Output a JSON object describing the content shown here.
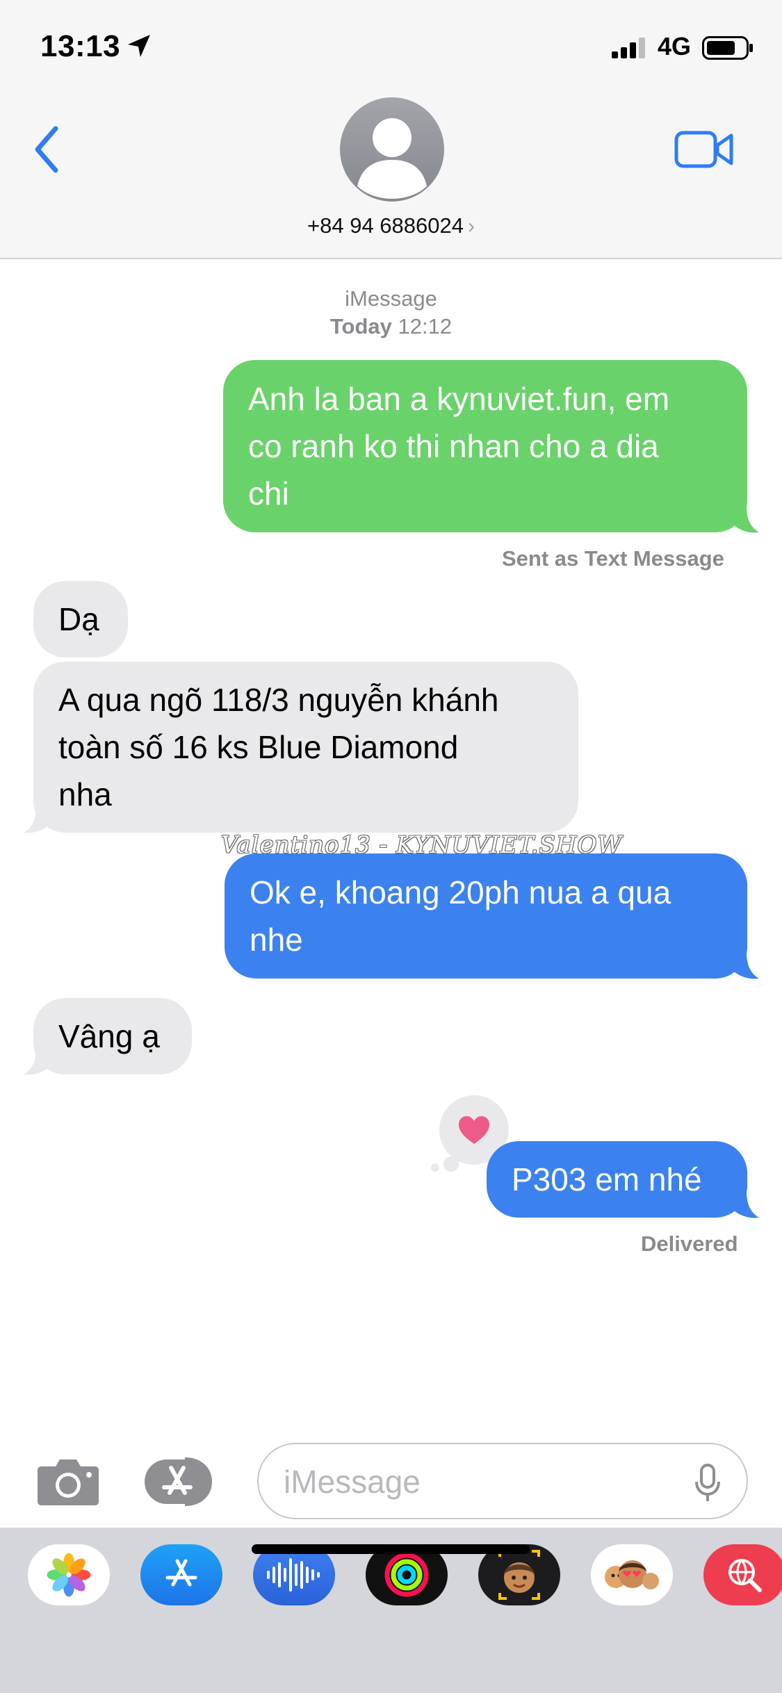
{
  "status_bar": {
    "time": "13:13",
    "network": "4G"
  },
  "header": {
    "contact": "+84 94 6886024",
    "chevron": "›"
  },
  "conversation": {
    "service": "iMessage",
    "day": "Today",
    "time": "12:12",
    "messages": [
      {
        "from": "me",
        "kind": "sms",
        "lines": [
          "Anh la ban a kynuviet.fun, em",
          "co ranh ko thi nhan cho a dia",
          "chi"
        ]
      },
      {
        "from": "them",
        "lines": [
          "Dạ"
        ]
      },
      {
        "from": "them",
        "lines": [
          "A qua ngõ 118/3 nguyễn khánh",
          "toàn số 16 ks Blue Diamond",
          "nha"
        ]
      },
      {
        "from": "me",
        "kind": "imessage",
        "lines": [
          "Ok e, khoang 20ph nua a qua",
          "nhe"
        ]
      },
      {
        "from": "them",
        "lines": [
          "Vâng ạ"
        ]
      },
      {
        "from": "me",
        "kind": "imessage",
        "lines": [
          "P303 em nhé"
        ],
        "reaction": "heart-icon"
      }
    ],
    "sent_note": "Sent as Text Message",
    "delivered_note": "Delivered",
    "watermark": "Valentino13 - KYNUVIET.SHOW"
  },
  "input": {
    "placeholder": "iMessage",
    "value": ""
  },
  "app_drawer": [
    "photos-app",
    "app-store-app",
    "audio-message-app",
    "activity-app",
    "memoji-app",
    "memoji-stickers-app",
    "images-search-app"
  ],
  "colors": {
    "sms_green": "#6ad26a",
    "imessage_blue": "#3b82f0",
    "received_gray": "#e9e9eb",
    "ios_blue": "#2f7cf6",
    "heart_pink": "#ee5b88"
  }
}
